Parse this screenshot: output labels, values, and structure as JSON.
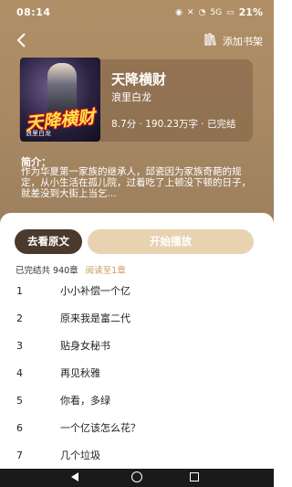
{
  "statusbar": {
    "time": "08:14",
    "signal_label": "5G",
    "battery": "21%"
  },
  "header": {
    "back_icon": "back-arrow-icon",
    "shelf_label": "添加书架",
    "shelf_icon": "bookshelf-icon"
  },
  "book": {
    "cover_title": "天降横财",
    "cover_author": "浪里白龙",
    "title": "天降横财",
    "author": "浪里白龙",
    "meta": "8.7分 · 190.23万字 · 已完结"
  },
  "intro": {
    "label": "简介：",
    "text": "作为华夏第一家族的继承人，邱瓷因为家族奇葩的规定，从小生活在孤儿院，过着吃了上顿没下顿的日子，就差没到大街上当乞..."
  },
  "actions": {
    "original_label": "去看原文",
    "play_label": "开始播放"
  },
  "chapter_info": {
    "summary": "已完结共 940章",
    "read_to": "阅读至1章"
  },
  "chapters": [
    {
      "num": "1",
      "name": "小小补偿一个亿"
    },
    {
      "num": "2",
      "name": "原来我是富二代"
    },
    {
      "num": "3",
      "name": "贴身女秘书"
    },
    {
      "num": "4",
      "name": "再见秋雅"
    },
    {
      "num": "5",
      "name": "你看，多绿"
    },
    {
      "num": "6",
      "name": "一个亿该怎么花？"
    },
    {
      "num": "7",
      "name": "几个垃圾"
    }
  ],
  "colors": {
    "hero_bg": "#a98a64",
    "original_button": "#4a3a2c",
    "play_button": "#e8d3b0",
    "accent": "#c79a5a"
  }
}
